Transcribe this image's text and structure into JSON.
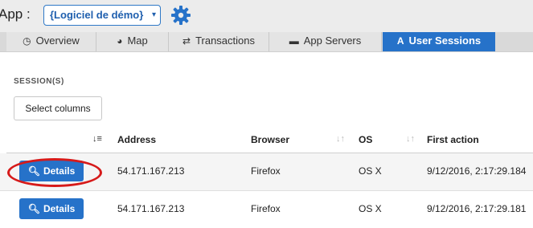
{
  "app": {
    "label": "App :",
    "selected": "{Logiciel de démo}",
    "caret": "▾",
    "settings_icon": "gear-icon"
  },
  "tabs": [
    {
      "label": "Overview",
      "icon": "dashboard-icon",
      "glyph": "◷",
      "active": false
    },
    {
      "label": "Map",
      "icon": "globe-icon",
      "glyph": "◕",
      "active": false
    },
    {
      "label": "Transactions",
      "icon": "exchange-icon",
      "glyph": "⇄",
      "active": false
    },
    {
      "label": "App Servers",
      "icon": "server-icon",
      "glyph": "▬",
      "active": false
    },
    {
      "label": "User Sessions",
      "icon": "user-sessions-icon",
      "glyph": "A",
      "active": true
    }
  ],
  "sessions": {
    "section_title": "SESSION(S)",
    "select_columns_label": "Select columns",
    "columns": [
      "Address",
      "Browser",
      "OS",
      "First action"
    ],
    "sort_glyphs": {
      "active": "↓≡",
      "inactive": "↓↑"
    },
    "details_label": "Details",
    "rows": [
      {
        "address": "54.171.167.213",
        "browser": "Firefox",
        "os": "OS X",
        "first_action": "9/12/2016, 2:17:29.184"
      },
      {
        "address": "54.171.167.213",
        "browser": "Firefox",
        "os": "OS X",
        "first_action": "9/12/2016, 2:17:29.181"
      }
    ]
  },
  "colors": {
    "accent": "#2672c9",
    "highlight": "#d61a1a"
  }
}
